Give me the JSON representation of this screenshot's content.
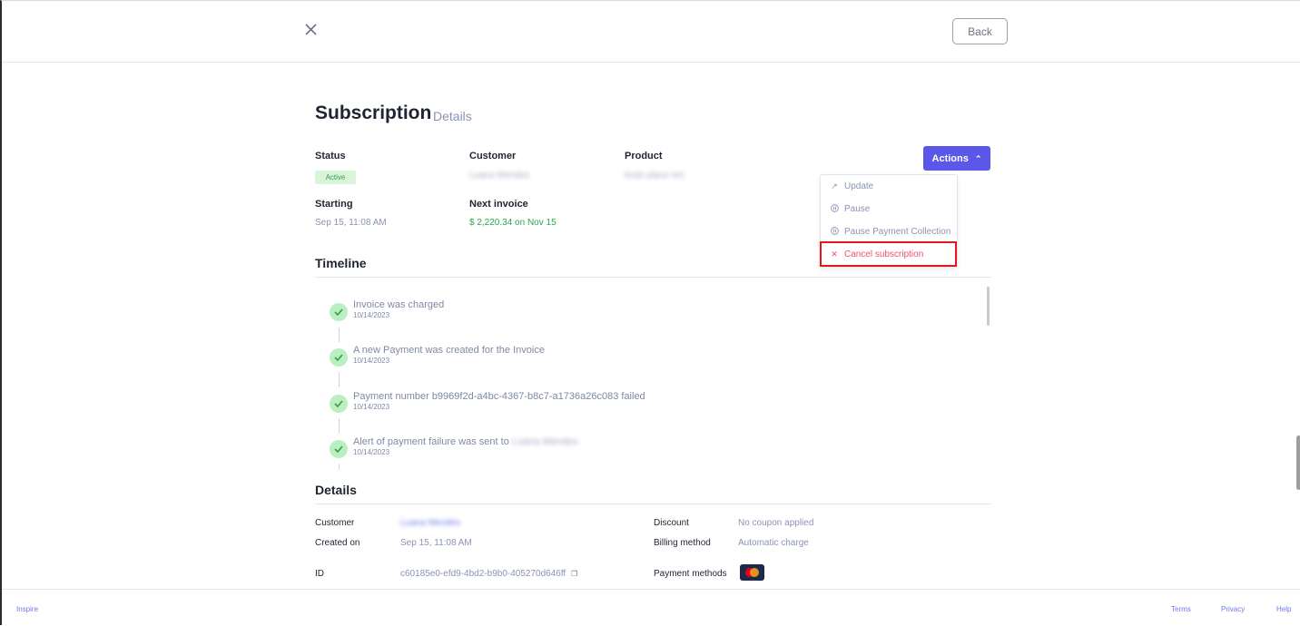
{
  "topbar": {
    "back_label": "Back"
  },
  "heading": {
    "title": "Subscription",
    "subtitle": "Details"
  },
  "summary": {
    "status_label": "Status",
    "status_value": "Active",
    "customer_label": "Customer",
    "customer_value": "Luana Mendes",
    "product_label": "Product",
    "product_value": "teste plano teri",
    "starting_label": "Starting",
    "starting_value": "Sep 15, 11:08 AM",
    "next_invoice_label": "Next invoice",
    "next_invoice_value": "$ 2,220.34 on Nov 15"
  },
  "actions": {
    "button_label": "Actions",
    "items": [
      {
        "icon": "arrow-up-right-icon",
        "label": "Update"
      },
      {
        "icon": "pause-icon",
        "label": "Pause"
      },
      {
        "icon": "pause-icon",
        "label": "Pause Payment Collection"
      },
      {
        "icon": "x-icon",
        "label": "Cancel subscription"
      }
    ]
  },
  "timeline": {
    "heading": "Timeline",
    "events": [
      {
        "text": "Invoice was charged",
        "date": "10/14/2023"
      },
      {
        "text": "A new Payment was created for the Invoice",
        "date": "10/14/2023"
      },
      {
        "text": "Payment number b9969f2d-a4bc-4367-b8c7-a1736a26c083 failed",
        "date": "10/14/2023"
      },
      {
        "text": "Alert of payment failure was sent to",
        "blurred": "Luana Mendes",
        "date": "10/14/2023"
      }
    ]
  },
  "details": {
    "heading": "Details",
    "customer_label": "Customer",
    "customer_value": "Luana Mendes",
    "created_label": "Created on",
    "created_value": "Sep 15, 11:08 AM",
    "id_label": "ID",
    "id_value": "c60185e0-efd9-4bd2-b9b0-405270d646ff",
    "discount_label": "Discount",
    "discount_value": "No coupon applied",
    "billing_label": "Billing method",
    "billing_value": "Automatic charge",
    "payment_label": "Payment methods"
  },
  "footer": {
    "brand": "Inspire",
    "terms": "Terms",
    "privacy": "Privacy",
    "help": "Help"
  },
  "colors": {
    "accent": "#5b57e8",
    "danger": "#f0506e",
    "success": "#2ea44f",
    "highlight": "#e8141e"
  }
}
